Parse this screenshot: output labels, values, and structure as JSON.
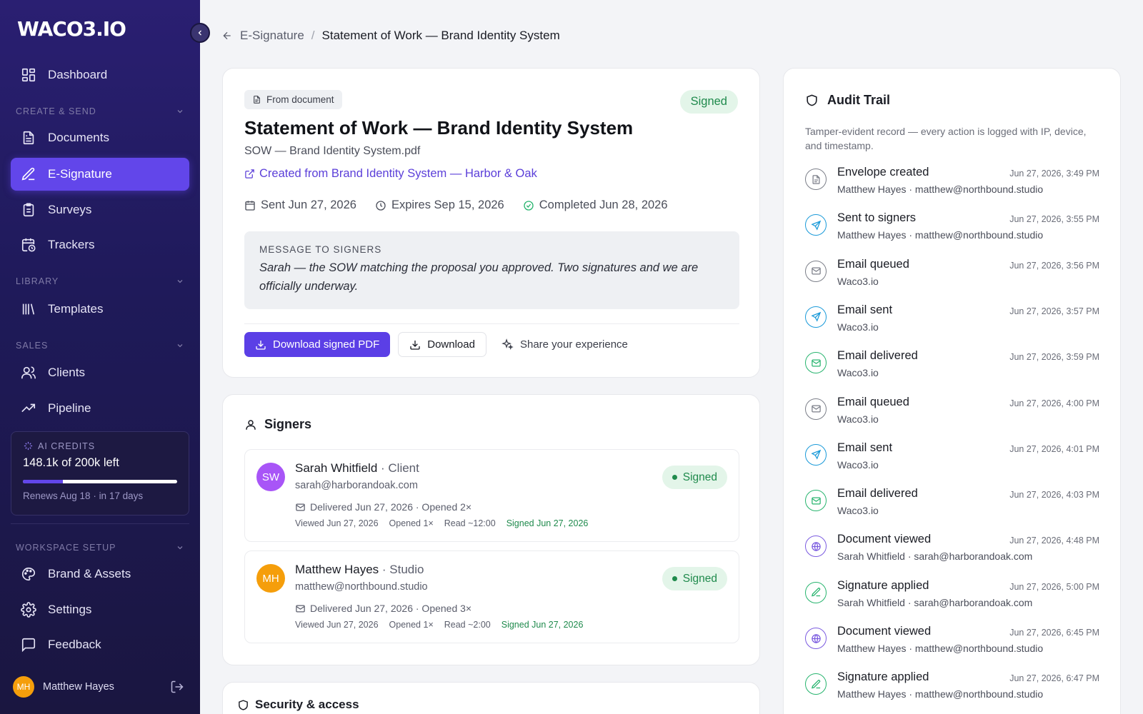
{
  "sidebar": {
    "logo": "WACO3.IO",
    "dashboard": "Dashboard",
    "sections": {
      "create_send": "CREATE & SEND",
      "library": "LIBRARY",
      "sales": "SALES",
      "workspace": "WORKSPACE SETUP"
    },
    "items": {
      "documents": "Documents",
      "esignature": "E-Signature",
      "surveys": "Surveys",
      "trackers": "Trackers",
      "templates": "Templates",
      "clients": "Clients",
      "pipeline": "Pipeline",
      "brand": "Brand & Assets",
      "settings": "Settings",
      "feedback": "Feedback"
    },
    "credits": {
      "label": "AI CREDITS",
      "amount": "148.1k of 200k left",
      "used_fraction": 0.26,
      "renews": "Renews Aug 18 · in 17 days"
    },
    "user": {
      "initials": "MH",
      "name": "Matthew Hayes"
    }
  },
  "breadcrumb": {
    "parent": "E-Signature",
    "separator": "/",
    "current": "Statement of Work — Brand Identity System"
  },
  "document": {
    "from_label": "From document",
    "status": "Signed",
    "title": "Statement of Work — Brand Identity System",
    "file": "SOW — Brand Identity System.pdf",
    "link": "Created from Brand Identity System — Harbor & Oak",
    "sent": "Sent Jun 27, 2026",
    "expires": "Expires Sep 15, 2026",
    "completed": "Completed Jun 28, 2026",
    "message_heading": "MESSAGE TO SIGNERS",
    "message": "Sarah — the SOW matching the proposal you approved. Two signatures and we are officially underway.",
    "actions": {
      "download_signed": "Download signed PDF",
      "download": "Download",
      "share": "Share your experience"
    }
  },
  "signers": {
    "title": "Signers",
    "list": [
      {
        "initials": "SW",
        "color": "#a855f7",
        "name": "Sarah Whitfield",
        "role": " · Client",
        "email": "sarah@harborandoak.com",
        "delivered": "Delivered Jun 27, 2026 · Opened 2×",
        "viewed": "Viewed Jun 27, 2026",
        "opened": "Opened 1×",
        "read": "Read ~12:00",
        "signed": "Signed Jun 27, 2026",
        "status": "Signed"
      },
      {
        "initials": "MH",
        "color": "#f59e0b",
        "name": "Matthew Hayes",
        "role": " · Studio",
        "email": "matthew@northbound.studio",
        "delivered": "Delivered Jun 27, 2026 · Opened 3×",
        "viewed": "Viewed Jun 27, 2026",
        "opened": "Opened 1×",
        "read": "Read ~2:00",
        "signed": "Signed Jun 27, 2026",
        "status": "Signed"
      }
    ]
  },
  "security": {
    "title": "Security & access"
  },
  "audit": {
    "title": "Audit Trail",
    "subtitle": "Tamper-evident record — every action is logged with IP, device, and timestamp.",
    "events": [
      {
        "title": "Envelope created",
        "who": "Matthew Hayes · matthew@northbound.studio",
        "time": "Jun 27, 2026, 3:49 PM",
        "icon": "document-icon",
        "color": "gray"
      },
      {
        "title": "Sent to signers",
        "who": "Matthew Hayes · matthew@northbound.studio",
        "time": "Jun 27, 2026, 3:55 PM",
        "icon": "send-icon",
        "color": "blue"
      },
      {
        "title": "Email queued",
        "who": "Waco3.io",
        "time": "Jun 27, 2026, 3:56 PM",
        "icon": "mail-icon",
        "color": "gray"
      },
      {
        "title": "Email sent",
        "who": "Waco3.io",
        "time": "Jun 27, 2026, 3:57 PM",
        "icon": "send-icon",
        "color": "blue"
      },
      {
        "title": "Email delivered",
        "who": "Waco3.io",
        "time": "Jun 27, 2026, 3:59 PM",
        "icon": "mail-icon",
        "color": "green"
      },
      {
        "title": "Email queued",
        "who": "Waco3.io",
        "time": "Jun 27, 2026, 4:00 PM",
        "icon": "mail-icon",
        "color": "gray"
      },
      {
        "title": "Email sent",
        "who": "Waco3.io",
        "time": "Jun 27, 2026, 4:01 PM",
        "icon": "send-icon",
        "color": "blue"
      },
      {
        "title": "Email delivered",
        "who": "Waco3.io",
        "time": "Jun 27, 2026, 4:03 PM",
        "icon": "mail-icon",
        "color": "green"
      },
      {
        "title": "Document viewed",
        "who": "Sarah Whitfield · sarah@harborandoak.com",
        "time": "Jun 27, 2026, 4:48 PM",
        "icon": "globe-icon",
        "color": "purple"
      },
      {
        "title": "Signature applied",
        "who": "Sarah Whitfield · sarah@harborandoak.com",
        "time": "Jun 27, 2026, 5:00 PM",
        "icon": "pen-icon",
        "color": "green"
      },
      {
        "title": "Document viewed",
        "who": "Matthew Hayes · matthew@northbound.studio",
        "time": "Jun 27, 2026, 6:45 PM",
        "icon": "globe-icon",
        "color": "purple"
      },
      {
        "title": "Signature applied",
        "who": "Matthew Hayes · matthew@northbound.studio",
        "time": "Jun 27, 2026, 6:47 PM",
        "icon": "pen-icon",
        "color": "green"
      }
    ]
  }
}
